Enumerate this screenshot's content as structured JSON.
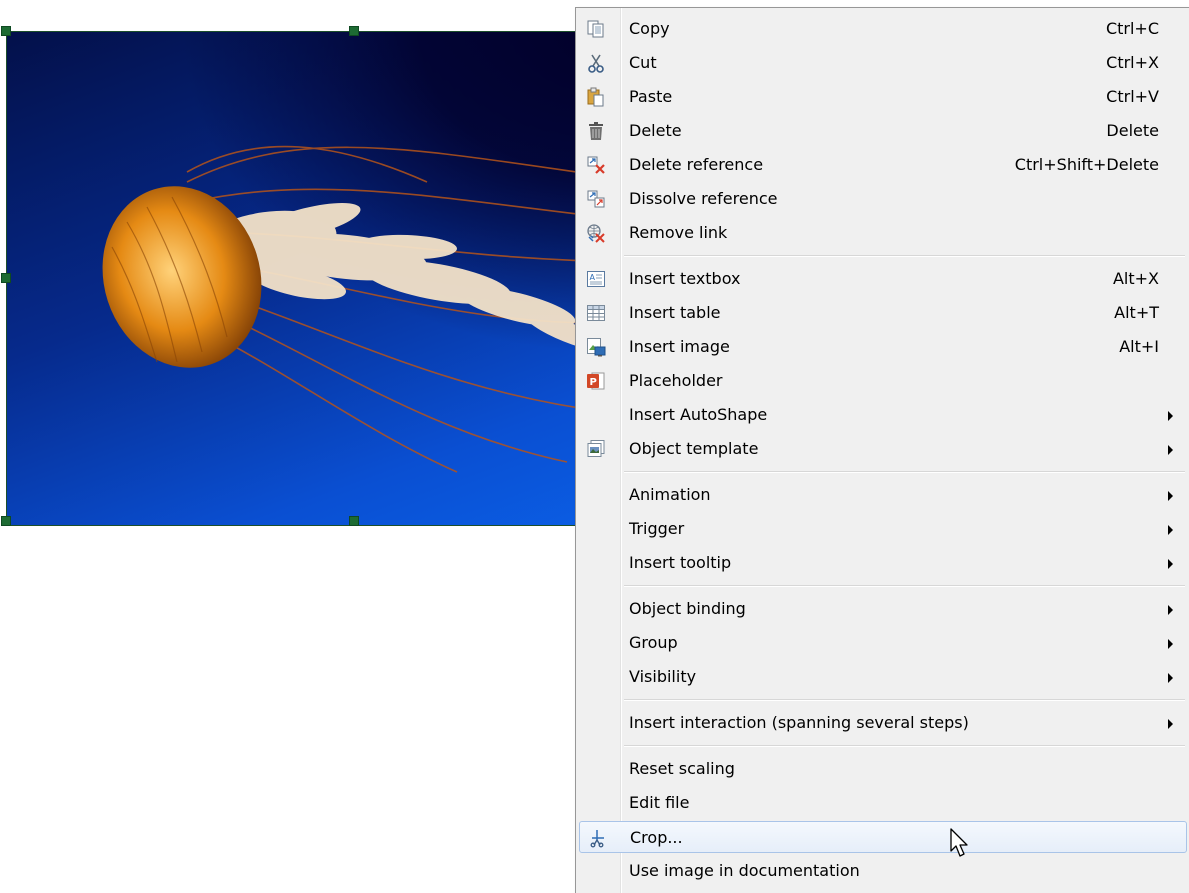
{
  "colors": {
    "menu_background": "#f0f0f0",
    "menu_border": "#979797",
    "highlight_border": "#a9c4e8",
    "selection_handle": "#1d6b33",
    "icon_blue": "#2f6db5",
    "icon_red": "#d83b2a"
  },
  "canvas": {
    "image_subject": "jellyfish photo"
  },
  "context_menu": {
    "items": [
      {
        "label": "Copy",
        "shortcut": "Ctrl+C",
        "icon": "copy-icon"
      },
      {
        "label": "Cut",
        "shortcut": "Ctrl+X",
        "icon": "scissors-icon"
      },
      {
        "label": "Paste",
        "shortcut": "Ctrl+V",
        "icon": "paste-icon"
      },
      {
        "label": "Delete",
        "shortcut": "Delete",
        "icon": "trash-icon"
      },
      {
        "label": "Delete reference",
        "shortcut": "Ctrl+Shift+Delete",
        "icon": "delete-reference-icon"
      },
      {
        "label": "Dissolve reference",
        "shortcut": "",
        "icon": "dissolve-reference-icon"
      },
      {
        "label": "Remove link",
        "shortcut": "",
        "icon": "remove-link-icon"
      },
      {
        "label": "Insert textbox",
        "shortcut": "Alt+X",
        "icon": "textbox-icon"
      },
      {
        "label": "Insert table",
        "shortcut": "Alt+T",
        "icon": "table-icon"
      },
      {
        "label": "Insert image",
        "shortcut": "Alt+I",
        "icon": "image-icon"
      },
      {
        "label": "Placeholder",
        "shortcut": "",
        "icon": "placeholder-icon"
      },
      {
        "label": "Insert AutoShape",
        "shortcut": "",
        "icon": "",
        "submenu": true
      },
      {
        "label": "Object template",
        "shortcut": "",
        "icon": "object-template-icon",
        "submenu": true
      },
      {
        "label": "Animation",
        "shortcut": "",
        "icon": "",
        "submenu": true
      },
      {
        "label": "Trigger",
        "shortcut": "",
        "icon": "",
        "submenu": true
      },
      {
        "label": "Insert tooltip",
        "shortcut": "",
        "icon": "",
        "submenu": true
      },
      {
        "label": "Object binding",
        "shortcut": "",
        "icon": "",
        "submenu": true
      },
      {
        "label": "Group",
        "shortcut": "",
        "icon": "",
        "submenu": true
      },
      {
        "label": "Visibility",
        "shortcut": "",
        "icon": "",
        "submenu": true
      },
      {
        "label": "Insert interaction (spanning several steps)",
        "shortcut": "",
        "icon": "",
        "submenu": true
      },
      {
        "label": "Reset scaling",
        "shortcut": "",
        "icon": ""
      },
      {
        "label": "Edit file",
        "shortcut": "",
        "icon": ""
      },
      {
        "label": "Crop...",
        "shortcut": "",
        "icon": "crop-icon",
        "highlighted": true
      },
      {
        "label": "Use image in documentation",
        "shortcut": "",
        "icon": ""
      }
    ]
  }
}
